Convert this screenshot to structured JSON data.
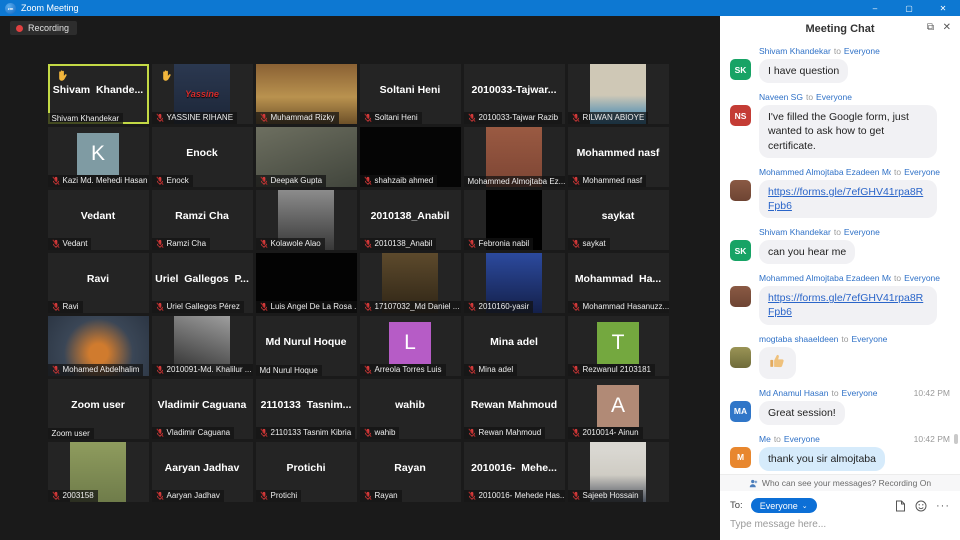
{
  "window": {
    "title": "Zoom Meeting",
    "app_icon": "zm",
    "minimize": "–",
    "maximize": "▢",
    "close": "✕"
  },
  "recording": {
    "label": "Recording"
  },
  "colors": {
    "titlebar": "#0d78d2",
    "active_border": "#c3d945",
    "muted_mic": "#d23b3b",
    "accent_blue": "#0c6fd6"
  },
  "participants": [
    {
      "type": "name",
      "center": "Shivam  Khande...",
      "label": "Shivam Khandekar",
      "mic": "none",
      "hand": true,
      "active": true
    },
    {
      "type": "photo",
      "fit": "center",
      "bg": "linear-gradient(180deg,#2b3850,#1c2638)",
      "overlay": "Yassine",
      "label": "YASSINE RIHANE",
      "mic": "muted",
      "hand": true
    },
    {
      "type": "photo",
      "fit": "full",
      "bg": "linear-gradient(180deg,#8a6134,#b9924f 55%,#6e5129)",
      "label": "Muhammad Rizky",
      "mic": "muted"
    },
    {
      "type": "name",
      "center": "Soltani Heni",
      "label": "Soltani Heni",
      "mic": "muted"
    },
    {
      "type": "name",
      "center": "2010033-Tajwar...",
      "label": "2010033-Tajwar Razib",
      "mic": "muted"
    },
    {
      "type": "photo",
      "fit": "center",
      "bg": "linear-gradient(180deg,#cfc8b6 52%,#2f7fb3)",
      "label": "RILWAN ABIOYE",
      "mic": "muted"
    },
    {
      "type": "letter",
      "letter": "K",
      "color": "#7f9ba3",
      "label": "Kazi Md. Mehedi Hasan",
      "mic": "muted"
    },
    {
      "type": "name",
      "center": "Enock",
      "label": "Enock",
      "mic": "muted"
    },
    {
      "type": "photo",
      "fit": "full",
      "bg": "linear-gradient(160deg,#6d6f60,#41453c)",
      "label": "Deepak Gupta",
      "mic": "muted"
    },
    {
      "type": "photo",
      "fit": "full",
      "bg": "#050505",
      "label": "shahzaib ahmed",
      "mic": "muted"
    },
    {
      "type": "photo",
      "fit": "center",
      "bg": "linear-gradient(180deg,#9a5a42,#7d4534)",
      "label": "Mohammed Almojtaba Ez...",
      "mic": "none"
    },
    {
      "type": "name",
      "center": "Mohammed nasf",
      "label": "Mohammed nasf",
      "mic": "muted"
    },
    {
      "type": "name",
      "center": "Vedant",
      "label": "Vedant",
      "mic": "muted"
    },
    {
      "type": "name",
      "center": "Ramzi Cha",
      "label": "Ramzi Cha",
      "mic": "muted"
    },
    {
      "type": "photo",
      "fit": "center",
      "bg": "linear-gradient(180deg,#8c8c8c,#383838)",
      "label": "Kolawole  Alao",
      "mic": "muted"
    },
    {
      "type": "name",
      "center": "2010138_Anabil",
      "label": "2010138_Anabil",
      "mic": "muted"
    },
    {
      "type": "photo",
      "fit": "center",
      "bg": "#000000",
      "label": "Febronia nabil",
      "mic": "muted"
    },
    {
      "type": "name",
      "center": "saykat",
      "label": "saykat",
      "mic": "muted"
    },
    {
      "type": "name",
      "center": "Ravi",
      "label": "Ravi",
      "mic": "muted"
    },
    {
      "type": "name",
      "center": "Uriel  Gallegos  P...",
      "label": "Uriel Gallegos Pérez",
      "mic": "muted"
    },
    {
      "type": "photo",
      "fit": "full",
      "bg": "#030303",
      "label": "Luis Angel De La Rosa ...",
      "mic": "muted"
    },
    {
      "type": "photo",
      "fit": "center",
      "bg": "linear-gradient(180deg,#5d4a2c,#2f2516)",
      "label": "17107032_Md Daniel ...",
      "mic": "muted"
    },
    {
      "type": "photo",
      "fit": "center",
      "bg": "linear-gradient(180deg,#2c4a9e,#14204a)",
      "label": "2010160-yasir",
      "mic": "muted"
    },
    {
      "type": "name",
      "center": "Mohammad  Ha...",
      "label": "Mohammad Hasanuzz...",
      "mic": "muted"
    },
    {
      "type": "photo",
      "fit": "full",
      "bg": "radial-gradient(circle at 50% 62%, #d07b2e 15%, #3a4656 55%, #2c3644)",
      "label": "Mohamed Abdelhalim",
      "mic": "muted"
    },
    {
      "type": "photo",
      "fit": "center",
      "bg": "linear-gradient(200deg,#9e9e9e,#2a2a2a)",
      "label": "2010091-Md. Khalilur ...",
      "mic": "muted"
    },
    {
      "type": "name",
      "center": "Md Nurul Hoque",
      "label": "Md Nurul Hoque",
      "mic": "none"
    },
    {
      "type": "letter",
      "letter": "L",
      "color": "#b65cc6",
      "label": "Arreola Torres Luis",
      "mic": "muted"
    },
    {
      "type": "name",
      "center": "Mina adel",
      "label": "Mina adel",
      "mic": "muted"
    },
    {
      "type": "letter",
      "letter": "T",
      "color": "#74a83f",
      "label": "Rezwanul 2103181",
      "mic": "muted"
    },
    {
      "type": "name",
      "center": "Zoom user",
      "label": "Zoom user",
      "mic": "none"
    },
    {
      "type": "name",
      "center": "Vladimir Caguana",
      "label": "Vladimir Caguana",
      "mic": "muted"
    },
    {
      "type": "name",
      "center": "2110133  Tasnim...",
      "label": "2110133 Tasnim Kibria",
      "mic": "muted"
    },
    {
      "type": "name",
      "center": "wahib",
      "label": "wahib",
      "mic": "muted"
    },
    {
      "type": "name",
      "center": "Rewan Mahmoud",
      "label": "Rewan Mahmoud",
      "mic": "muted"
    },
    {
      "type": "letter",
      "letter": "A",
      "color": "#b18a76",
      "label": "2010014- Ainun",
      "mic": "muted"
    },
    {
      "type": "photo",
      "fit": "center",
      "bg": "linear-gradient(180deg,#8f9c5e,#6f7c4a)",
      "label": "2003158",
      "mic": "muted"
    },
    {
      "type": "name",
      "center": "Aaryan Jadhav",
      "label": "Aaryan Jadhav",
      "mic": "muted"
    },
    {
      "type": "name",
      "center": "Protichi",
      "label": "Protichi",
      "mic": "muted"
    },
    {
      "type": "name",
      "center": "Rayan",
      "label": "Rayan",
      "mic": "muted"
    },
    {
      "type": "name",
      "center": "2010016-  Mehe...",
      "label": "2010016- Mehede Has...",
      "mic": "muted"
    },
    {
      "type": "photo",
      "fit": "center",
      "bg": "linear-gradient(180deg,#d9d7d1 15%,#cfccc4 55%,#49505c)",
      "label": "Sajeeb Hossain",
      "mic": "muted"
    }
  ],
  "chat": {
    "title": "Meeting Chat",
    "to_word": "to",
    "messages": [
      {
        "sender": "Shivam Khandekar",
        "recipient": "Everyone",
        "avatar": {
          "kind": "initials",
          "text": "SK",
          "color": "#17a365"
        },
        "text": "I have question"
      },
      {
        "sender": "Naveen SG",
        "recipient": "Everyone",
        "avatar": {
          "kind": "initials",
          "text": "NS",
          "color": "#c43c35"
        },
        "text": "I've filled the Google form, just wanted to ask how to get certificate."
      },
      {
        "sender": "Mohammed Almojtaba Ezadeen Moham...",
        "recipient": "Everyone",
        "avatar": {
          "kind": "photo",
          "color": "linear-gradient(180deg,#8a5a44,#6e4433)"
        },
        "link": "https://forms.gle/7efGHV41rpa8RFpb6"
      },
      {
        "sender": "Shivam Khandekar",
        "recipient": "Everyone",
        "avatar": {
          "kind": "initials",
          "text": "SK",
          "color": "#17a365"
        },
        "text": "can you hear me"
      },
      {
        "sender": "Mohammed Almojtaba Ezadeen Moham...",
        "recipient": "Everyone",
        "avatar": {
          "kind": "photo",
          "color": "linear-gradient(180deg,#8a5a44,#6e4433)"
        },
        "link": "https://forms.gle/7efGHV41rpa8RFpb6"
      },
      {
        "sender": "mogtaba shaaeldeen",
        "recipient": "Everyone",
        "avatar": {
          "kind": "photo",
          "color": "linear-gradient(180deg,#9a9456,#6f6b3a)"
        },
        "emoji": "thumbs-up"
      },
      {
        "sender": "Md Anamul Hasan",
        "recipient": "Everyone",
        "time": "10:42 PM",
        "avatar": {
          "kind": "initials",
          "text": "MA",
          "color": "#3076c8"
        },
        "text": "Great session!"
      },
      {
        "sender": "Me",
        "recipient": "Everyone",
        "time": "10:42 PM",
        "avatar": {
          "kind": "initials",
          "text": "M",
          "color": "#e8872e"
        },
        "text": "thank you sir almojtaba",
        "own": true
      }
    ],
    "notice": "Who can see your messages? Recording On",
    "to_label": "To:",
    "recipient_selected": "Everyone",
    "placeholder": "Type message here..."
  }
}
